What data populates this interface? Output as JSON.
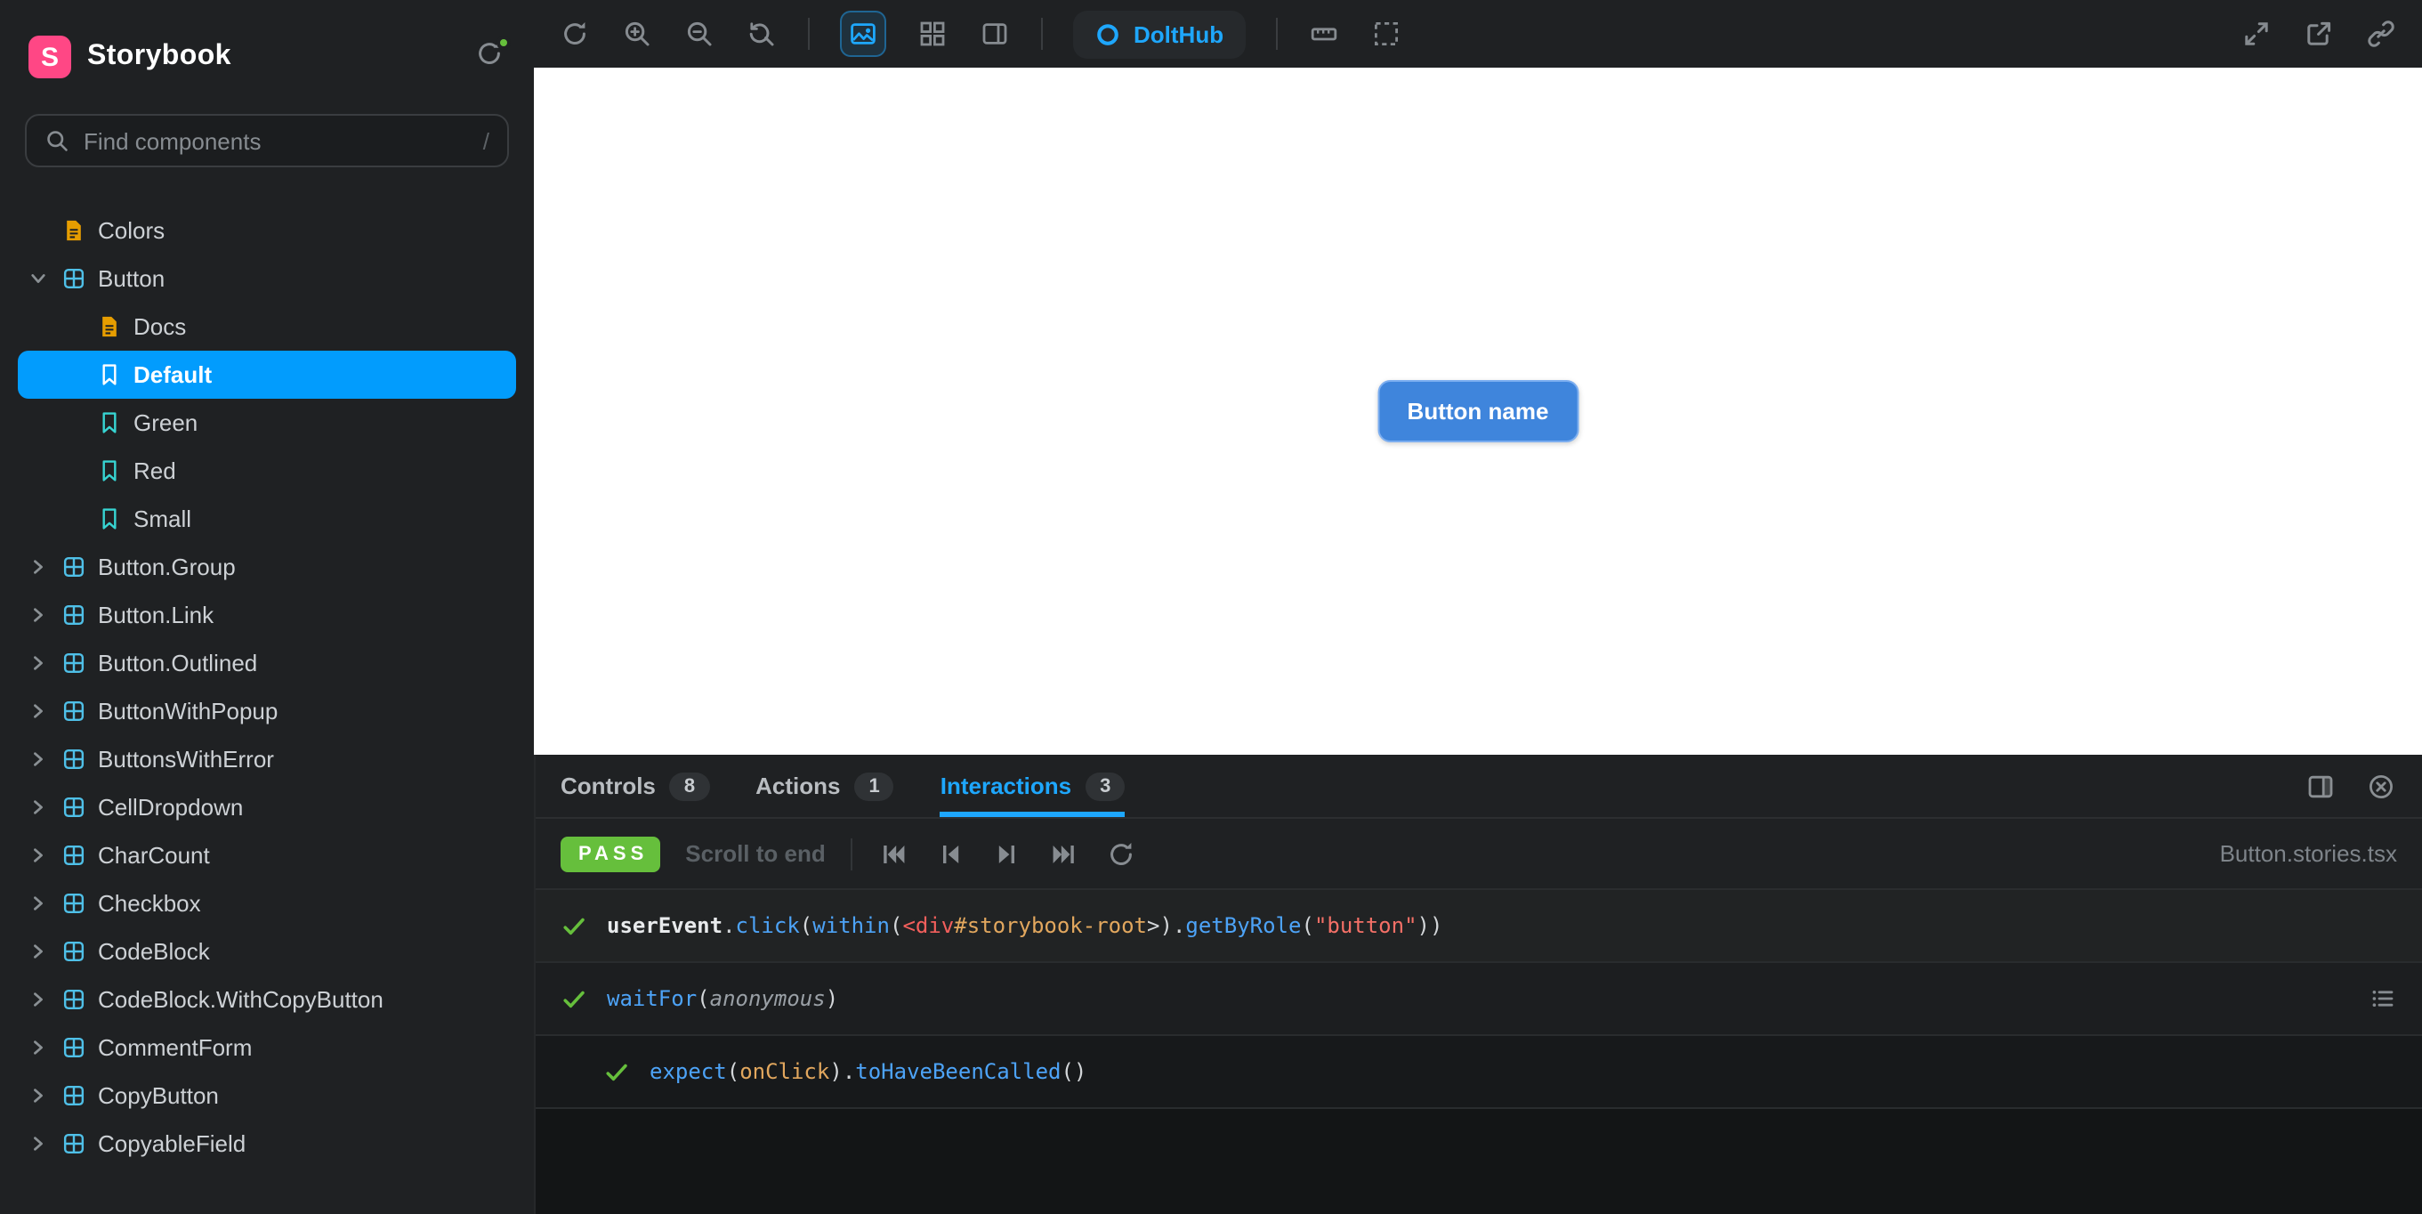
{
  "colors": {
    "accent": "#1ea7fd",
    "selected_bg": "#029cfd",
    "pass_green": "#66bf3c",
    "brand_pink": "#ff4785",
    "doc_icon": "#e69d00",
    "component_icon": "#4fc0e8",
    "story_icon": "#37d5d3",
    "preview_button_blue": "#3f85dc"
  },
  "sidebar": {
    "brand": "Storybook",
    "logo_letter": "S",
    "search": {
      "placeholder": "Find components",
      "shortcut": "/"
    },
    "tree": [
      {
        "type": "doc",
        "label": "Colors",
        "depth": 0
      },
      {
        "type": "component",
        "label": "Button",
        "depth": 0,
        "expanded": true
      },
      {
        "type": "doc",
        "label": "Docs",
        "depth": 1
      },
      {
        "type": "story",
        "label": "Default",
        "depth": 1,
        "selected": true
      },
      {
        "type": "story",
        "label": "Green",
        "depth": 1
      },
      {
        "type": "story",
        "label": "Red",
        "depth": 1
      },
      {
        "type": "story",
        "label": "Small",
        "depth": 1
      },
      {
        "type": "component",
        "label": "Button.Group",
        "depth": 0
      },
      {
        "type": "component",
        "label": "Button.Link",
        "depth": 0
      },
      {
        "type": "component",
        "label": "Button.Outlined",
        "depth": 0
      },
      {
        "type": "component",
        "label": "ButtonWithPopup",
        "depth": 0
      },
      {
        "type": "component",
        "label": "ButtonsWithError",
        "depth": 0
      },
      {
        "type": "component",
        "label": "CellDropdown",
        "depth": 0
      },
      {
        "type": "component",
        "label": "CharCount",
        "depth": 0
      },
      {
        "type": "component",
        "label": "Checkbox",
        "depth": 0
      },
      {
        "type": "component",
        "label": "CodeBlock",
        "depth": 0
      },
      {
        "type": "component",
        "label": "CodeBlock.WithCopyButton",
        "depth": 0
      },
      {
        "type": "component",
        "label": "CommentForm",
        "depth": 0
      },
      {
        "type": "component",
        "label": "CopyButton",
        "depth": 0
      },
      {
        "type": "component",
        "label": "CopyableField",
        "depth": 0
      }
    ]
  },
  "toolbar": {
    "addon_label": "DoltHub"
  },
  "canvas": {
    "button_label": "Button name"
  },
  "panel": {
    "tabs": [
      {
        "label": "Controls",
        "badge": "8",
        "active": false
      },
      {
        "label": "Actions",
        "badge": "1",
        "active": false
      },
      {
        "label": "Interactions",
        "badge": "3",
        "active": true
      }
    ],
    "status": "PASS",
    "scroll_label": "Scroll to end",
    "file": "Button.stories.tsx",
    "interactions": [
      {
        "depth": 0,
        "status": "pass",
        "has_menu": false,
        "tokens": [
          [
            "userEvent",
            "obj"
          ],
          [
            ".",
            "p"
          ],
          [
            "click",
            "m"
          ],
          [
            "(",
            "p"
          ],
          [
            "within",
            "m"
          ],
          [
            "(",
            "p"
          ],
          [
            "<div",
            "tag"
          ],
          [
            "#storybook-root",
            "id"
          ],
          [
            ">",
            "p"
          ],
          [
            ")",
            "p"
          ],
          [
            ".",
            "p"
          ],
          [
            "getByRole",
            "m"
          ],
          [
            "(",
            "p"
          ],
          [
            "\"button\"",
            "str"
          ],
          [
            "))",
            "p"
          ]
        ]
      },
      {
        "depth": 0,
        "status": "pass",
        "has_menu": true,
        "tokens": [
          [
            "waitFor",
            "m"
          ],
          [
            "(",
            "p"
          ],
          [
            "anonymous",
            "anon"
          ],
          [
            ")",
            "p"
          ]
        ]
      },
      {
        "depth": 1,
        "status": "pass",
        "has_menu": false,
        "tokens": [
          [
            "expect",
            "m"
          ],
          [
            "(",
            "p"
          ],
          [
            "onClick",
            "id"
          ],
          [
            ")",
            "p"
          ],
          [
            ".",
            "p"
          ],
          [
            "toHaveBeenCalled",
            "m"
          ],
          [
            "()",
            "p"
          ]
        ]
      }
    ]
  }
}
